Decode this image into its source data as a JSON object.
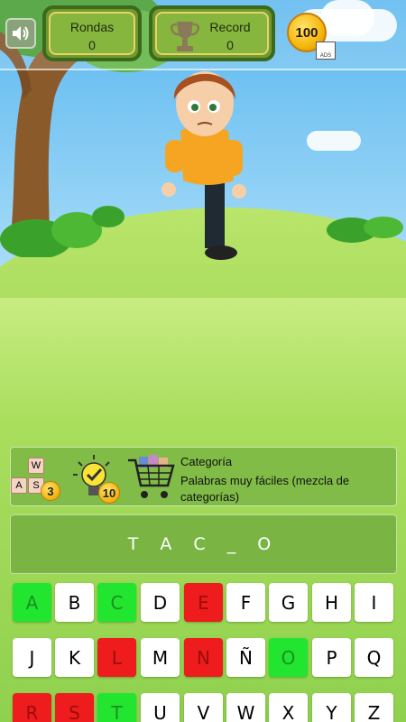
{
  "header": {
    "sound_icon": "speaker-icon",
    "rounds_label": "Rondas",
    "rounds_value": "0",
    "record_label": "Record",
    "record_value": "0",
    "record_icon": "trophy-icon",
    "coins": "100",
    "ads_label": "ADS"
  },
  "hints": {
    "letters_badge": "3",
    "bulb_badge": "10",
    "tile_letters": [
      "W",
      "A",
      "S"
    ]
  },
  "category": {
    "label": "Categoría",
    "value": "Palabras muy fáciles (mezcla de categorías)"
  },
  "word": "T A C _ O",
  "keyboard": {
    "rows": [
      [
        "A",
        "B",
        "C",
        "D",
        "E",
        "F",
        "G",
        "H",
        "I"
      ],
      [
        "J",
        "K",
        "L",
        "M",
        "N",
        "Ñ",
        "O",
        "P",
        "Q"
      ],
      [
        "R",
        "S",
        "T",
        "U",
        "V",
        "W",
        "X",
        "Y",
        "Z"
      ]
    ],
    "correct": [
      "A",
      "C",
      "O",
      "T"
    ],
    "wrong": [
      "E",
      "L",
      "N",
      "R",
      "S"
    ]
  },
  "colors": {
    "correct": "#22e52f",
    "wrong": "#ee1c1c",
    "neutral": "#ffffff",
    "panel_bg": "#7ab544"
  }
}
